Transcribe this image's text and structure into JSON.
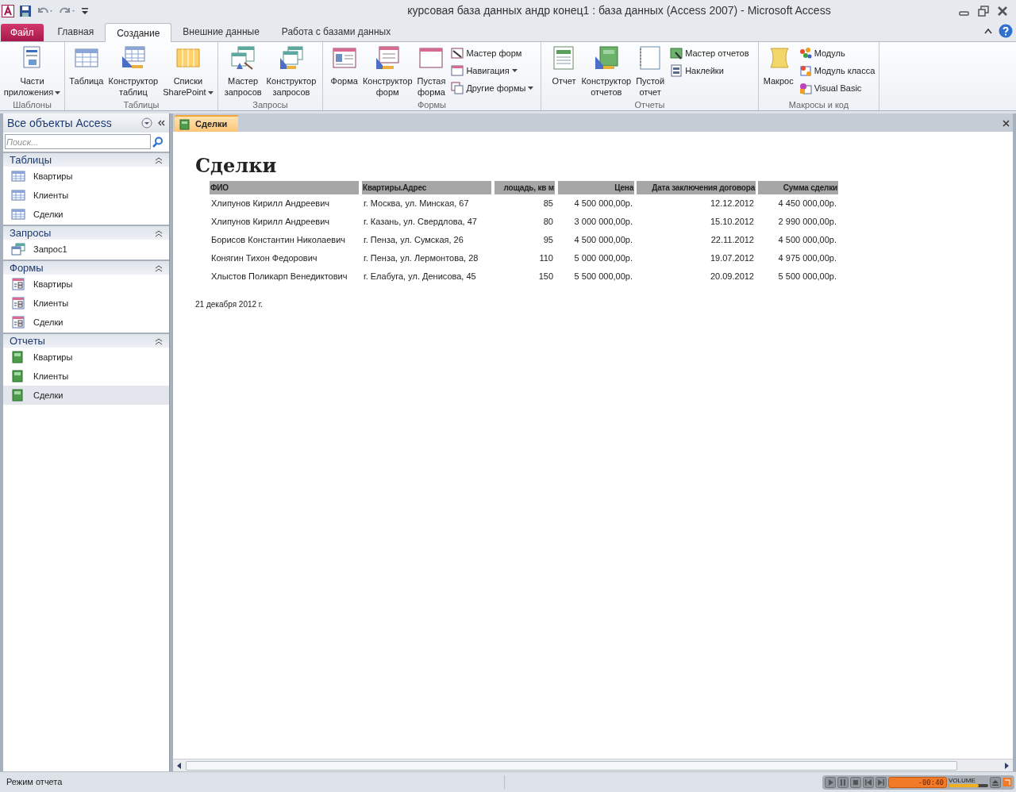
{
  "window": {
    "title": "курсовая база данных андр конец1 : база данных (Access 2007)  -  Microsoft Access"
  },
  "ribbon_tabs": [
    {
      "label": "Файл",
      "kind": "file",
      "selected": false
    },
    {
      "label": "Главная",
      "kind": "tab",
      "selected": false
    },
    {
      "label": "Создание",
      "kind": "tab",
      "selected": true
    },
    {
      "label": "Внешние данные",
      "kind": "tab",
      "selected": false
    },
    {
      "label": "Работа с базами данных",
      "kind": "tab",
      "selected": false
    }
  ],
  "ribbon_groups": [
    {
      "label": "Шаблоны",
      "large": [
        {
          "label": "Части\nприложения",
          "dropdown": true
        }
      ]
    },
    {
      "label": "Таблицы",
      "large": [
        {
          "label": "Таблица",
          "dropdown": false
        },
        {
          "label": "Конструктор\nтаблиц",
          "dropdown": false
        },
        {
          "label": "Списки\nSharePoint",
          "dropdown": true
        }
      ]
    },
    {
      "label": "Запросы",
      "large": [
        {
          "label": "Мастер\nзапросов",
          "dropdown": false
        },
        {
          "label": "Конструктор\nзапросов",
          "dropdown": false
        }
      ]
    },
    {
      "label": "Формы",
      "large": [
        {
          "label": "Форма",
          "dropdown": false
        },
        {
          "label": "Конструктор\nформ",
          "dropdown": false
        },
        {
          "label": "Пустая\nформа",
          "dropdown": false
        }
      ],
      "small": [
        {
          "label": "Мастер форм",
          "dropdown": false
        },
        {
          "label": "Навигация",
          "dropdown": true
        },
        {
          "label": "Другие формы",
          "dropdown": true
        }
      ]
    },
    {
      "label": "Отчеты",
      "large": [
        {
          "label": "Отчет",
          "dropdown": false
        },
        {
          "label": "Конструктор\nотчетов",
          "dropdown": false
        },
        {
          "label": "Пустой\nотчет",
          "dropdown": false
        }
      ],
      "small": [
        {
          "label": "Мастер отчетов",
          "dropdown": false
        },
        {
          "label": "Наклейки",
          "dropdown": false
        }
      ]
    },
    {
      "label": "Макросы и код",
      "large": [
        {
          "label": "Макрос",
          "dropdown": false
        }
      ],
      "small": [
        {
          "label": "Модуль",
          "dropdown": false
        },
        {
          "label": "Модуль класса",
          "dropdown": false
        },
        {
          "label": "Visual Basic",
          "dropdown": false
        }
      ]
    }
  ],
  "nav_pane": {
    "title": "Все объекты Access",
    "search": {
      "placeholder": "Поиск..."
    },
    "sections": [
      {
        "label": "Таблицы",
        "expanded": true,
        "items": [
          {
            "label": "Квартиры",
            "selected": false
          },
          {
            "label": "Клиенты",
            "selected": false
          },
          {
            "label": "Сделки",
            "selected": false
          }
        ]
      },
      {
        "label": "Запросы",
        "expanded": true,
        "items": [
          {
            "label": "Запрос1",
            "selected": false
          }
        ]
      },
      {
        "label": "Формы",
        "expanded": true,
        "items": [
          {
            "label": "Квартиры",
            "selected": false
          },
          {
            "label": "Клиенты",
            "selected": false
          },
          {
            "label": "Сделки",
            "selected": false
          }
        ]
      },
      {
        "label": "Отчеты",
        "expanded": true,
        "items": [
          {
            "label": "Квартиры",
            "selected": false
          },
          {
            "label": "Клиенты",
            "selected": false
          },
          {
            "label": "Сделки",
            "selected": true
          }
        ]
      }
    ]
  },
  "document_tabs": [
    {
      "label": "Сделки",
      "selected": true
    }
  ],
  "report": {
    "title": "Сделки",
    "columns": [
      "ФИО",
      "Квартиры.Адрес",
      "лощадь, кв м",
      "Цена",
      "Дата заключения договора",
      "Сумма сделки"
    ],
    "rows": [
      [
        "Хлипунов Кирилл Андреевич",
        "г. Москва, ул. Минская, 67",
        "85",
        "4 500 000,00р.",
        "12.12.2012",
        "4 450 000,00р."
      ],
      [
        "Хлипунов Кирилл Андреевич",
        "г. Казань, ул. Свердлова, 47",
        "80",
        "3 000 000,00р.",
        "15.10.2012",
        "2 990 000,00р."
      ],
      [
        "Борисов Константин Николаевич",
        "г. Пенза, ул. Сумская, 26",
        "95",
        "4 500 000,00р.",
        "22.11.2012",
        "4 500 000,00р."
      ],
      [
        "Конягин Тихон Федорович",
        "г. Пенза, ул. Лермонтова, 28",
        "110",
        "5 000 000,00р.",
        "19.07.2012",
        "4 975 000,00р."
      ],
      [
        "Хлыстов Поликарп Венедиктович",
        "г. Елабуга, ул. Денисова, 45",
        "150",
        "5 500 000,00р.",
        "20.09.2012",
        "5 500 000,00р."
      ]
    ],
    "date": "21 декабря 2012 г."
  },
  "status_bar": {
    "text": "Режим отчета"
  },
  "player": {
    "time": "-00:40",
    "volume_label": "VOLUME",
    "volume": {
      "level": 0.75
    }
  }
}
